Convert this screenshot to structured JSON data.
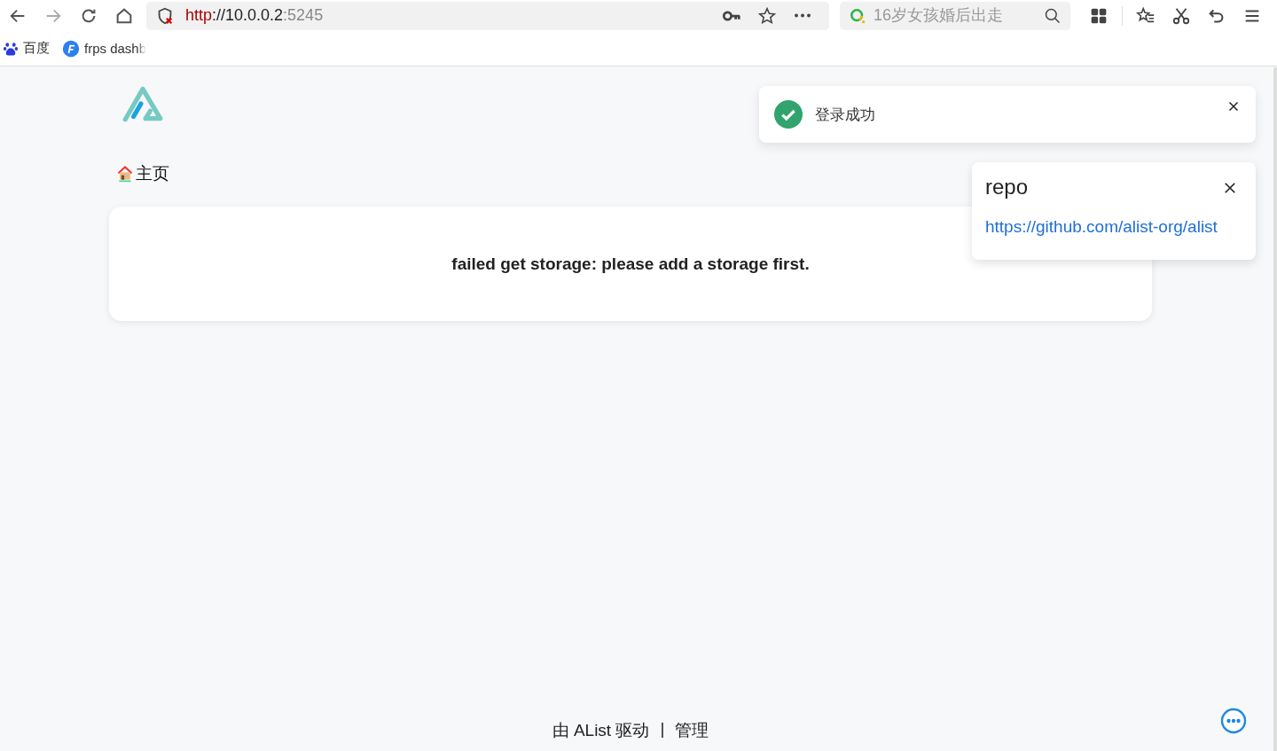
{
  "browser": {
    "url": {
      "scheme": "http",
      "host": "://10.0.0.2",
      "port": ":5245"
    },
    "search": {
      "placeholder": "16岁女孩婚后出走"
    },
    "bookmarks": [
      {
        "label": "百度",
        "kind": "paw"
      },
      {
        "label": "frps dashb",
        "kind": "frps"
      }
    ]
  },
  "breadcrumb": {
    "label": "主页"
  },
  "message": "failed get storage: please add a storage first.",
  "toast": {
    "text": "登录成功"
  },
  "notification": {
    "title": "repo",
    "link": "https://github.com/alist-org/alist"
  },
  "footer": {
    "powered": "由 AList 驱动",
    "separator": "|",
    "manage": "管理"
  }
}
